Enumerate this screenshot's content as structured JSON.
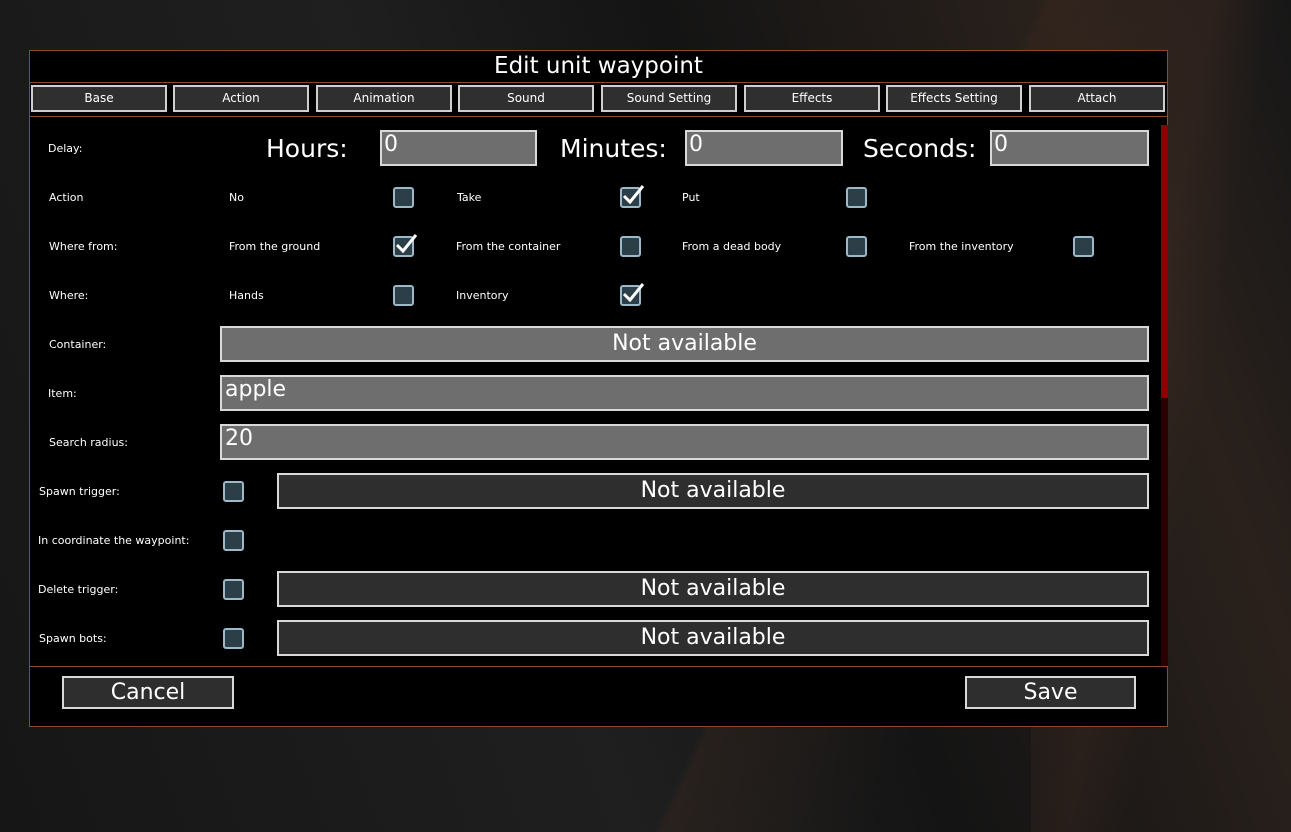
{
  "dialog": {
    "title": "Edit unit waypoint"
  },
  "tabs": [
    "Base",
    "Action",
    "Animation",
    "Sound",
    "Sound Setting",
    "Effects",
    "Effects Setting",
    "Attach"
  ],
  "delay": {
    "label": "Delay:",
    "hours_label": "Hours:",
    "hours_value": "0",
    "minutes_label": "Minutes:",
    "minutes_value": "0",
    "seconds_label": "Seconds:",
    "seconds_value": "0"
  },
  "action": {
    "label": "Action",
    "options": [
      {
        "label": "No",
        "checked": false
      },
      {
        "label": "Take",
        "checked": true
      },
      {
        "label": "Put",
        "checked": false
      }
    ]
  },
  "where_from": {
    "label": "Where from:",
    "options": [
      {
        "label": "From the ground",
        "checked": true
      },
      {
        "label": "From the container",
        "checked": false
      },
      {
        "label": "From a dead body",
        "checked": false
      },
      {
        "label": "From the inventory",
        "checked": false
      }
    ]
  },
  "where": {
    "label": "Where:",
    "options": [
      {
        "label": "Hands",
        "checked": false
      },
      {
        "label": "Inventory",
        "checked": true
      }
    ]
  },
  "container": {
    "label": "Container:",
    "value": "Not available"
  },
  "item": {
    "label": "Item:",
    "value": "apple"
  },
  "search_radius": {
    "label": "Search radius:",
    "value": "20"
  },
  "spawn_trigger": {
    "label": "Spawn trigger:",
    "checked": false,
    "value": "Not available"
  },
  "in_coordinate": {
    "label": "In coordinate the waypoint:",
    "checked": false
  },
  "delete_trigger": {
    "label": "Delete trigger:",
    "checked": false,
    "value": "Not available"
  },
  "spawn_bots": {
    "label": "Spawn bots:",
    "checked": false,
    "value": "Not available"
  },
  "footer": {
    "cancel_label": "Cancel",
    "save_label": "Save"
  },
  "colors": {
    "border": "#8a4a2f",
    "field": "#6e6e6e",
    "dark_field": "#2e2e2e",
    "scroll_thumb": "#8b0000"
  },
  "icons": {
    "checkmark": "checkmark-icon"
  }
}
